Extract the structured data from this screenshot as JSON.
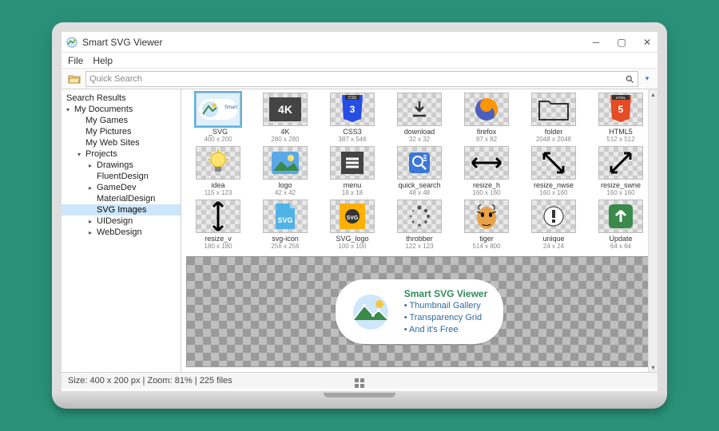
{
  "app_title": "Smart SVG Viewer",
  "menu": {
    "file": "File",
    "help": "Help"
  },
  "search": {
    "placeholder": "Quick Search"
  },
  "tree": {
    "search_results": "Search Results",
    "nodes": [
      {
        "label": "My Documents",
        "level": 0,
        "expand": "▾"
      },
      {
        "label": "My Games",
        "level": 1
      },
      {
        "label": "My Pictures",
        "level": 1
      },
      {
        "label": "My Web Sites",
        "level": 1
      },
      {
        "label": "Projects",
        "level": 1,
        "expand": "▾"
      },
      {
        "label": "Drawings",
        "level": 2,
        "expand": "▸"
      },
      {
        "label": "FluentDesign",
        "level": 2
      },
      {
        "label": "GameDev",
        "level": 2,
        "expand": "▸"
      },
      {
        "label": "MaterialDesign",
        "level": 2
      },
      {
        "label": "SVG Images",
        "level": 2,
        "selected": true
      },
      {
        "label": "UIDesign",
        "level": 2,
        "expand": "▸"
      },
      {
        "label": "WebDesign",
        "level": 2,
        "expand": "▸"
      }
    ]
  },
  "thumbs": [
    {
      "name": "_SVG",
      "dim": "400 x 200",
      "icon": "svg-logo",
      "selected": true
    },
    {
      "name": "4K",
      "dim": "280 x 280",
      "icon": "4k"
    },
    {
      "name": "CSS3",
      "dim": "387 x 546",
      "icon": "css3"
    },
    {
      "name": "download",
      "dim": "32 x 32",
      "icon": "download"
    },
    {
      "name": "firefox",
      "dim": "87 x 82",
      "icon": "firefox"
    },
    {
      "name": "folder",
      "dim": "2048 x 2048",
      "icon": "folder"
    },
    {
      "name": "HTML5",
      "dim": "512 x 512",
      "icon": "html5"
    },
    {
      "name": "idea",
      "dim": "115 x 123",
      "icon": "idea"
    },
    {
      "name": "logo",
      "dim": "42 x 42",
      "icon": "logo"
    },
    {
      "name": "menu",
      "dim": "18 x 18",
      "icon": "menu"
    },
    {
      "name": "quick_search",
      "dim": "48 x 48",
      "icon": "search"
    },
    {
      "name": "resize_h",
      "dim": "160 x 160",
      "icon": "resize-h"
    },
    {
      "name": "resize_nwse",
      "dim": "160 x 160",
      "icon": "resize-nwse"
    },
    {
      "name": "resize_swne",
      "dim": "160 x 160",
      "icon": "resize-swne"
    },
    {
      "name": "resize_v",
      "dim": "180 x 180",
      "icon": "resize-v"
    },
    {
      "name": "svg-icon",
      "dim": "256 x 256",
      "icon": "svg-file"
    },
    {
      "name": "SVG_logo",
      "dim": "100 x 100",
      "icon": "svg-star"
    },
    {
      "name": "throbber",
      "dim": "122 x 123",
      "icon": "throbber"
    },
    {
      "name": "tiger",
      "dim": "514 x 800",
      "icon": "tiger"
    },
    {
      "name": "unique",
      "dim": "24 x 24",
      "icon": "unique"
    },
    {
      "name": "Update",
      "dim": "64 x 64",
      "icon": "update"
    }
  ],
  "preview": {
    "title": "Smart SVG Viewer",
    "lines": [
      "• Thumbnail Gallery",
      "• Transparency Grid",
      "• And it's Free"
    ]
  },
  "status": "Size: 400 x 200 px | Zoom: 81% | 225 files"
}
